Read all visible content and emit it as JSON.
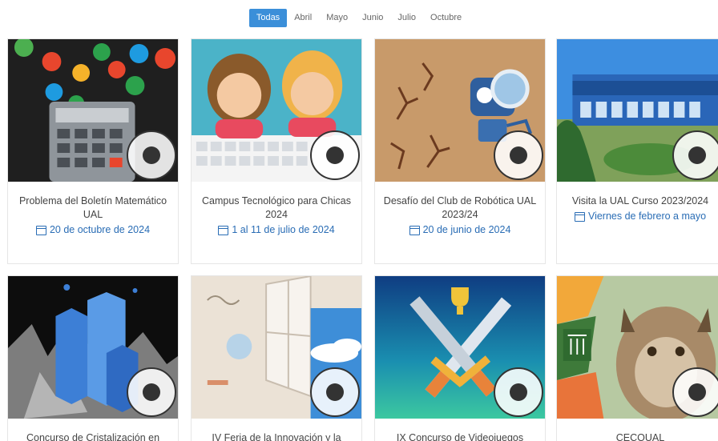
{
  "filters": {
    "todas": "Todas",
    "abril": "Abril",
    "mayo": "Mayo",
    "junio": "Junio",
    "julio": "Julio",
    "octubre": "Octubre"
  },
  "cards": [
    {
      "title": "Problema del Boletín Matemático UAL",
      "date": "20 de octubre de 2024"
    },
    {
      "title": "Campus Tecnológico para Chicas 2024",
      "date": "1 al 11 de julio de 2024"
    },
    {
      "title": "Desafío del Club de Robótica UAL 2023/24",
      "date": "20 de junio de 2024"
    },
    {
      "title": "Visita la UAL Curso 2023/2024",
      "date": "Viernes de febrero a mayo"
    },
    {
      "title": "Concurso de Cristalización en",
      "date": ""
    },
    {
      "title": "IV Feria de la Innovación y la",
      "date": ""
    },
    {
      "title": "IX Concurso de Videojuegos",
      "date": ""
    },
    {
      "title": "CECOUAL",
      "date": ""
    }
  ],
  "colors": {
    "accent": "#3b8fd9",
    "date_text": "#2a6db5"
  }
}
